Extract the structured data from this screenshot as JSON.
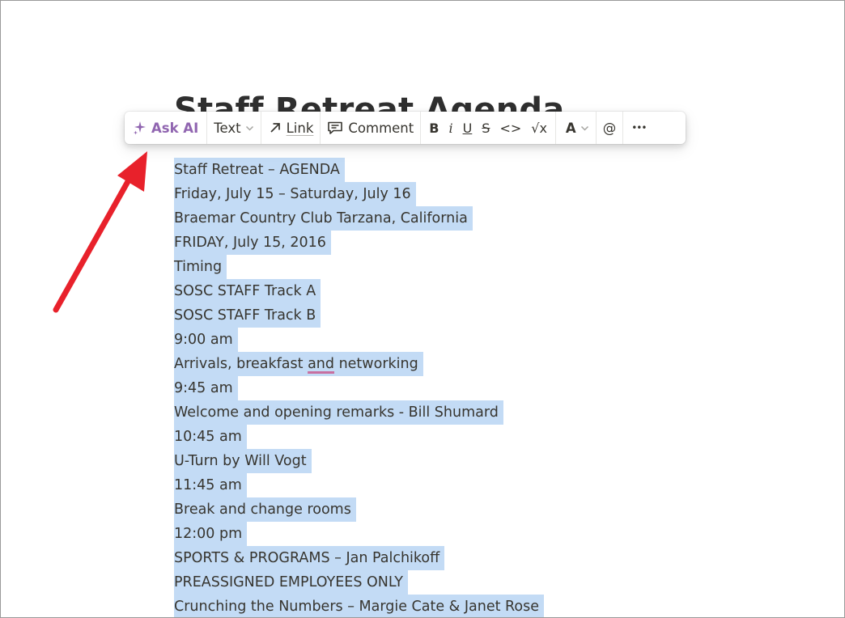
{
  "page": {
    "title": "Staff Retreat Agenda"
  },
  "toolbar": {
    "ask_ai": "Ask AI",
    "text": "Text",
    "link": "Link",
    "comment": "Comment",
    "bold": "B",
    "italic": "i",
    "underline": "U",
    "strike": "S",
    "code": "<>",
    "equation": "√x",
    "color": "A",
    "mention": "@",
    "more": "•••",
    "icons": {
      "ask_ai": "sparkle-icon",
      "text": "chevron-down-icon",
      "link": "arrow-up-right-icon",
      "comment": "comment-icon",
      "color": "chevron-down-icon"
    },
    "accent_color": "#9065b0"
  },
  "annotation": {
    "arrow_color": "#e8212b"
  },
  "selection_color": "#c3dbf5",
  "lines": [
    "Staff Retreat – AGENDA",
    "Friday, July 15 – Saturday, July 16",
    "Braemar Country Club Tarzana, California",
    "FRIDAY, July 15, 2016",
    "Timing",
    "SOSC STAFF Track A",
    "SOSC STAFF Track B",
    "9:00 am",
    {
      "before": "Arrivals, breakfast ",
      "flagged": "and",
      "after": " networking"
    },
    "9:45 am",
    "Welcome and opening remarks - Bill Shumard",
    "10:45 am",
    "U-Turn by Will Vogt",
    "11:45 am",
    "Break and change rooms",
    "12:00 pm",
    "SPORTS & PROGRAMS – Jan Palchikoff",
    "PREASSIGNED EMPLOYEES ONLY",
    "Crunching the Numbers – Margie Cate & Janet Rose"
  ]
}
